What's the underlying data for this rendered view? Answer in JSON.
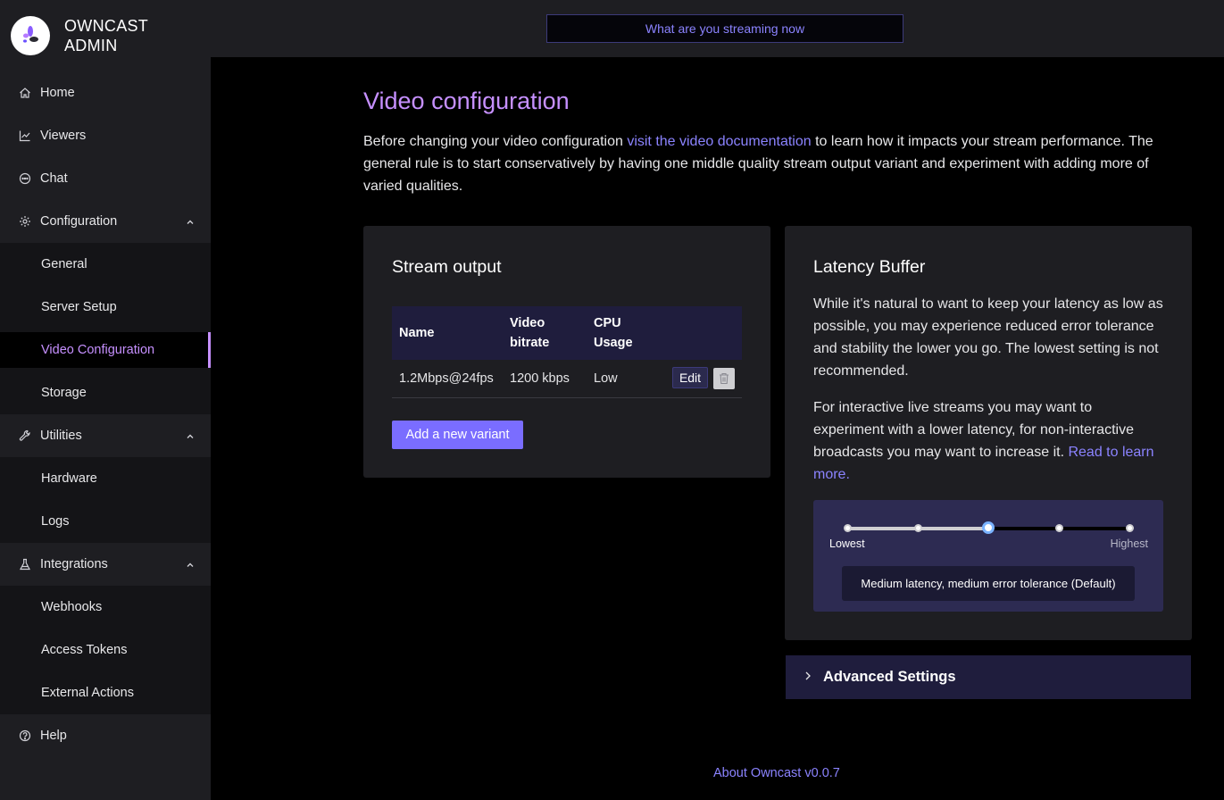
{
  "brand": {
    "line1": "OWNCAST",
    "line2": "ADMIN"
  },
  "header": {
    "stream_title": "What are you streaming now"
  },
  "sidebar": {
    "home": "Home",
    "viewers": "Viewers",
    "chat": "Chat",
    "configuration": {
      "label": "Configuration",
      "items": [
        "General",
        "Server Setup",
        "Video Configuration",
        "Storage"
      ]
    },
    "utilities": {
      "label": "Utilities",
      "items": [
        "Hardware",
        "Logs"
      ]
    },
    "integrations": {
      "label": "Integrations",
      "items": [
        "Webhooks",
        "Access Tokens",
        "External Actions"
      ]
    },
    "help": "Help",
    "active_item": "Video Configuration"
  },
  "main": {
    "title": "Video configuration",
    "intro_before": "Before changing your video configuration ",
    "intro_link": "visit the video documentation",
    "intro_after": " to learn how it impacts your stream performance. The general rule is to start conservatively by having one middle quality stream output variant and experiment with adding more of varied qualities."
  },
  "stream_output": {
    "title": "Stream output",
    "columns": {
      "name": "Name",
      "bitrate_1": "Video",
      "bitrate_2": "bitrate",
      "cpu_1": "CPU",
      "cpu_2": "Usage"
    },
    "rows": [
      {
        "name": "1.2Mbps@24fps",
        "bitrate": "1200 kbps",
        "cpu": "Low",
        "edit": "Edit"
      }
    ],
    "add_button": "Add a new variant"
  },
  "latency": {
    "title": "Latency Buffer",
    "para1": "While it's natural to want to keep your latency as low as possible, you may experience reduced error tolerance and stability the lower you go. The lowest setting is not recommended.",
    "para2_before": "For interactive live streams you may want to experiment with a lower latency, for non-interactive broadcasts you may want to increase it. ",
    "para2_link": "Read to learn more.",
    "slider": {
      "min_label": "Lowest",
      "max_label": "Highest",
      "steps": 5,
      "selected_index": 2,
      "tooltip": "Medium latency, medium error tolerance (Default)"
    }
  },
  "advanced": {
    "label": "Advanced Settings"
  },
  "footer": {
    "about": "About Owncast v0.0.7"
  },
  "colors": {
    "accent": "#c690ff",
    "link": "#8b83ff",
    "button": "#7a6dff",
    "panel": "#1e1e22"
  }
}
